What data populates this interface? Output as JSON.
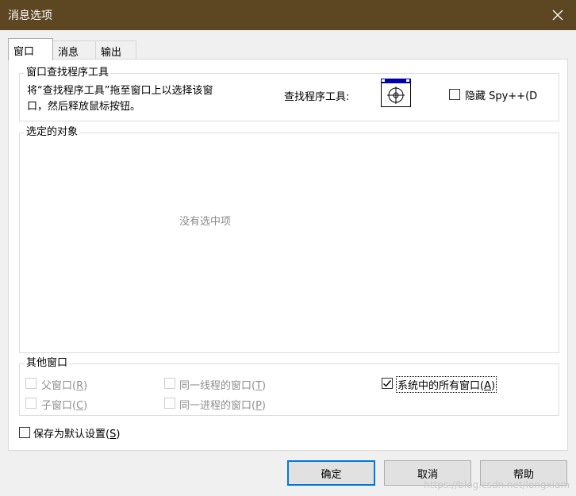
{
  "window": {
    "title": "消息选项"
  },
  "tabs": [
    {
      "label": "窗口"
    },
    {
      "label": "消息"
    },
    {
      "label": "输出"
    }
  ],
  "finder": {
    "group_label": "窗口查找程序工具",
    "instructions_line1": "将“查找程序工具”拖至窗口上以选择该窗",
    "instructions_line2": "口，然后释放鼠标按钮。",
    "tool_label": "查找程序工具:",
    "hide_checkbox_label": "隐藏 Spy++(D"
  },
  "selected": {
    "group_label": "选定的对象",
    "empty_text": "没有选中项"
  },
  "other_windows": {
    "group_label": "其他窗口",
    "parent": {
      "text": "父窗口(",
      "key": "R",
      "tail": ")"
    },
    "child": {
      "text": "子窗口(",
      "key": "C",
      "tail": ")"
    },
    "same_thread": {
      "text": "同一线程的窗口(",
      "key": "T",
      "tail": ")"
    },
    "same_process": {
      "text": "同一进程的窗口(",
      "key": "P",
      "tail": ")"
    },
    "all_system": {
      "text": "系统中的所有窗口(",
      "key": "A",
      "tail": ")",
      "checked": true
    }
  },
  "save_default": {
    "text": "保存为默认设置(",
    "key": "S",
    "tail": ")"
  },
  "buttons": {
    "ok": "确定",
    "cancel": "取消",
    "help": "帮助"
  },
  "watermark": "https://blog.csdn.net/longxiam",
  "colors": {
    "titlebar": "#5d4622",
    "accent": "#0078d7"
  }
}
